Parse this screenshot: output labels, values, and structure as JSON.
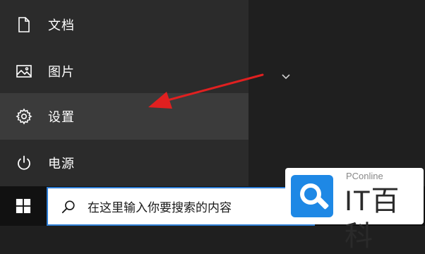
{
  "start_menu": {
    "items": [
      {
        "label": "文档",
        "icon": "document-icon"
      },
      {
        "label": "图片",
        "icon": "pictures-icon"
      },
      {
        "label": "设置",
        "icon": "gear-icon",
        "active": true
      },
      {
        "label": "电源",
        "icon": "power-icon"
      }
    ]
  },
  "taskbar": {
    "search_placeholder": "在这里输入你要搜索的内容"
  },
  "watermark": {
    "subtitle": "PConline",
    "brand": "IT百科"
  },
  "colors": {
    "menu_bg": "#2b2b2b",
    "active_item_bg": "#3b3b3b",
    "arrow": "#e02020",
    "search_border": "#2e7ed6",
    "logo_blue": "#1e88e5"
  }
}
